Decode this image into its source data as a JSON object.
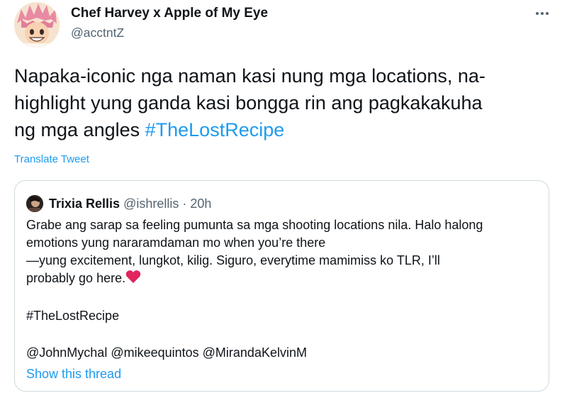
{
  "author": {
    "name": "Chef Harvey x Apple of My Eye",
    "handle": "@acctntZ",
    "avatar_icon": "anime-character-avatar"
  },
  "tweet": {
    "lines": [
      "Napaka-iconic nga naman kasi nung mga locations, na-",
      "highlight yung ganda kasi bongga rin ang pagkakakuha",
      "ng mga angles "
    ],
    "hashtag": "#TheLostRecipe",
    "translate_label": "Translate Tweet"
  },
  "quoted": {
    "name": "Trixia Rellis",
    "handle": "@ishrellis",
    "separator": "·",
    "time": "20h",
    "body_lines": [
      "Grabe ang sarap sa feeling pumunta sa mga shooting locations nila. Halo halong",
      "emotions yung nararamdaman mo when you’re there",
      "—yung excitement, lungkot, kilig. Siguro, everytime mamimiss ko TLR, I’ll",
      "probably go here."
    ],
    "emoji": "red-heart-icon",
    "hashtag": "#TheLostRecipe",
    "mentions": "@JohnMychal @mikeequintos @MirandaKelvinM",
    "show_thread_label": "Show this thread"
  },
  "colors": {
    "link": "#1d9bf0",
    "secondary_text": "#536471",
    "border": "#cfd9de",
    "heart": "#e0245e"
  }
}
